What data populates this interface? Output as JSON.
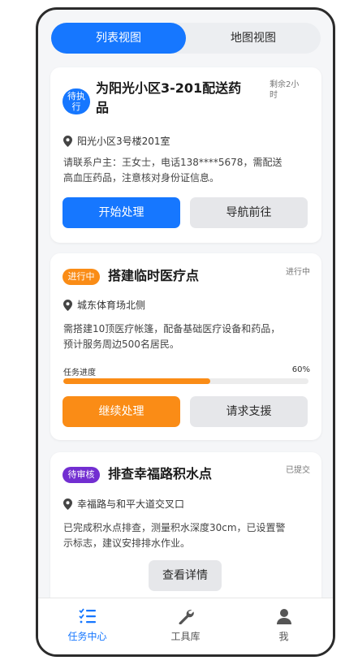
{
  "view_toggle": {
    "list": "列表视图",
    "map": "地图视图",
    "active": "list"
  },
  "tasks": [
    {
      "status": "待执行",
      "status_color": "#1677ff",
      "title_line1": "为阳光小区3-201配送药",
      "title_line2": "品",
      "meta_line1": "剩余2小",
      "meta_line2": "时",
      "location": "阳光小区3号楼201室",
      "desc_line1": "请联系户主：王女士，电话138****5678，需配送",
      "desc_line2": "高血压药品，注意核对身份证信息。",
      "buttons": [
        "开始处理",
        "导航前往"
      ]
    },
    {
      "status": "进行中",
      "status_color": "#fa8c16",
      "title": "搭建临时医疗点",
      "meta": "进行中",
      "location": "城东体育场北侧",
      "desc_line1": "需搭建10顶医疗帐篷，配备基础医疗设备和药品，",
      "desc_line2": "预计服务周边500名居民。",
      "progress_label": "任务进度",
      "progress_text": "60%",
      "progress_value": 0.6,
      "buttons": [
        "继续处理",
        "请求支援"
      ]
    },
    {
      "status": "待审核",
      "status_color": "#722ed1",
      "title": "排查幸福路积水点",
      "meta": "已提交",
      "location": "幸福路与和平大道交叉口",
      "desc_line1": "已完成积水点排查，测量积水深度30cm，已设置警",
      "desc_line2": "示标志，建议安排排水作业。",
      "buttons": [
        "查看详情"
      ]
    }
  ],
  "tabbar": [
    {
      "label": "任务中心",
      "icon": "task-list-icon",
      "active": true
    },
    {
      "label": "工具库",
      "icon": "wrench-icon",
      "active": false
    },
    {
      "label": "我",
      "icon": "user-icon",
      "active": false
    }
  ],
  "colors": {
    "primary": "#1677ff",
    "orange": "#fa8c16",
    "purple": "#722ed1"
  }
}
